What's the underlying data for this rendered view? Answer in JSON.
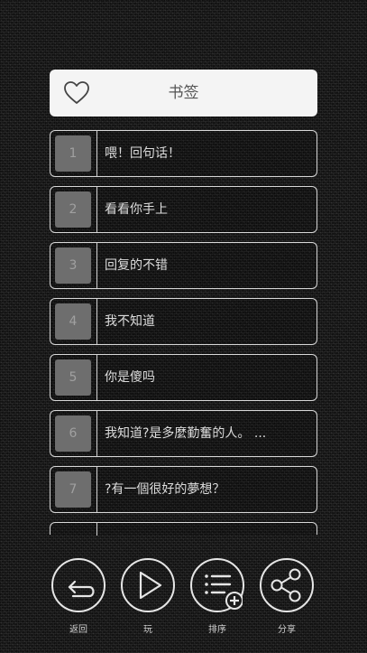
{
  "header": {
    "title": "书签",
    "icon": "heart-icon"
  },
  "bookmarks": [
    {
      "index": "1",
      "text": "喂！回句话！"
    },
    {
      "index": "2",
      "text": "看看你手上"
    },
    {
      "index": "3",
      "text": "回复的不错"
    },
    {
      "index": "4",
      "text": "我不知道"
    },
    {
      "index": "5",
      "text": "你是傻吗"
    },
    {
      "index": "6",
      "text": "我知道?是多麼勤奮的人。 ..."
    },
    {
      "index": "7",
      "text": "?有一個很好的夢想？"
    }
  ],
  "toolbar": {
    "back_label": "返回",
    "play_label": "玩",
    "sort_label": "排序",
    "share_label": "分享"
  },
  "colors": {
    "header_bg": "#f4f4f4",
    "border": "#d8d8d8",
    "number_box": "#6e6e6e"
  }
}
